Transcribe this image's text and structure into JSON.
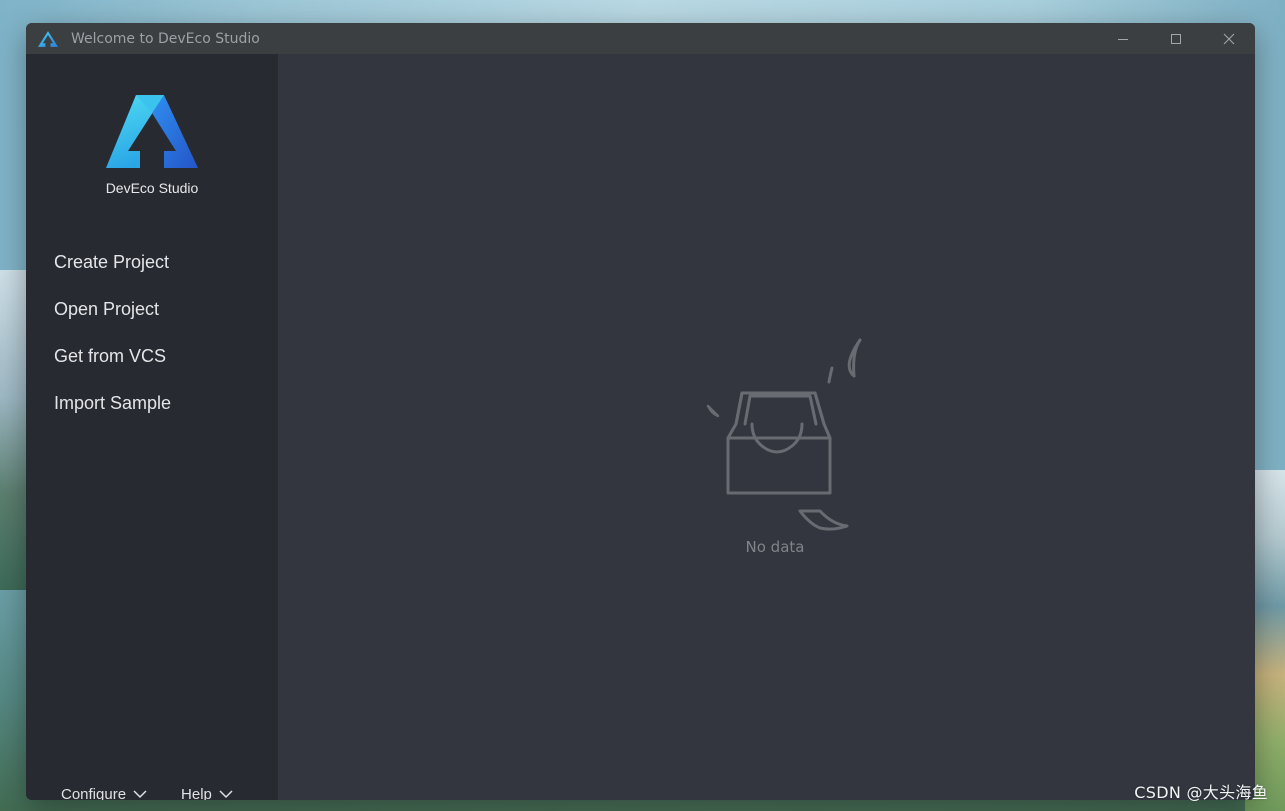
{
  "window": {
    "title": "Welcome to DevEco Studio",
    "controls": [
      "minimize",
      "maximize",
      "close"
    ]
  },
  "brand": {
    "name": "DevEco Studio",
    "logo_icon": "deveco-logo-icon"
  },
  "nav": {
    "items": [
      {
        "label": "Create Project"
      },
      {
        "label": "Open Project"
      },
      {
        "label": "Get from VCS"
      },
      {
        "label": "Import Sample"
      }
    ]
  },
  "bottom_menu": {
    "configure": "Configure",
    "help": "Help"
  },
  "main": {
    "empty_text": "No data",
    "empty_icon": "empty-inbox-icon"
  },
  "watermark": "CSDN @大头海鱼",
  "colors": {
    "titlebar": "#3c3f41",
    "sidebar": "#282a31",
    "main": "#33363e",
    "logo_light": "#39c6e6",
    "logo_dark": "#2a6fd8"
  }
}
